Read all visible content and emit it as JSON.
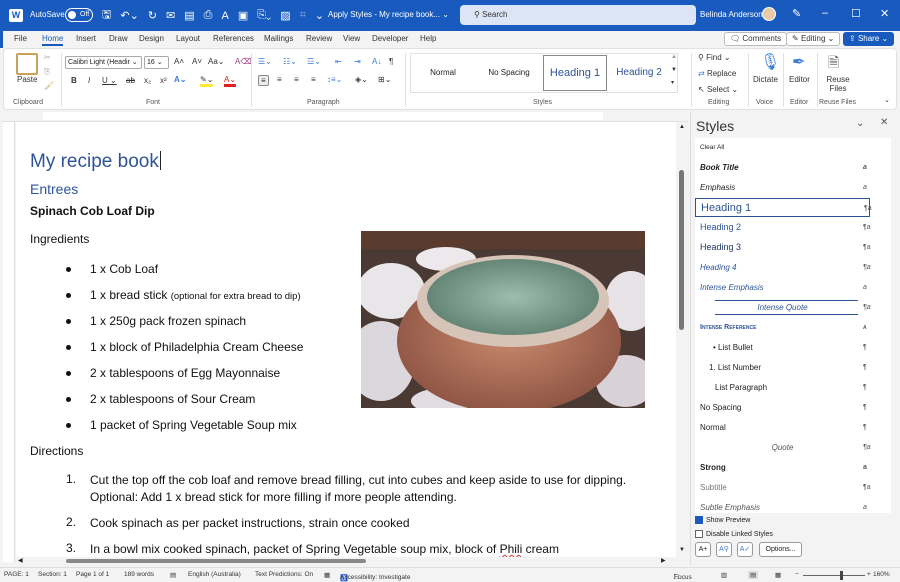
{
  "titlebar": {
    "app_icon": "W",
    "autosave_label": "AutoSave",
    "autosave_state": "Off",
    "quick_access_icons": [
      "save-icon",
      "undo-icon",
      "redo-icon",
      "mail-icon",
      "print-preview-icon",
      "print-icon",
      "read-aloud-icon",
      "form-icon",
      "paste-special-icon",
      "screenshot-icon",
      "touch-mode-icon",
      "customize-icon"
    ],
    "doc_title": "Apply Styles - My recipe book... ⌄",
    "search_placeholder": "Search",
    "user_name": "Belinda Anderson",
    "minimize": "–",
    "maximize": "☐",
    "close": "✕"
  },
  "menu": {
    "tabs": [
      "File",
      "Home",
      "Insert",
      "Draw",
      "Design",
      "Layout",
      "References",
      "Mailings",
      "Review",
      "View",
      "Developer",
      "Help"
    ],
    "active": "Home",
    "comments_label": "Comments",
    "editing_label": "Editing ⌄",
    "share_label": "Share"
  },
  "ribbon": {
    "clipboard": {
      "paste": "Paste",
      "label": "Clipboard"
    },
    "font": {
      "name": "Calibri Light (Headir",
      "size": "16",
      "label": "Font"
    },
    "paragraph": {
      "label": "Paragraph"
    },
    "styles": {
      "items": [
        "Normal",
        "No Spacing",
        "Heading 1",
        "Heading 2"
      ],
      "selected": "Heading 1",
      "label": "Styles"
    },
    "editing": {
      "find": "Find",
      "replace": "Replace",
      "select": "Select",
      "label": "Editing"
    },
    "voice": {
      "dictate": "Dictate",
      "label": "Voice"
    },
    "editor": {
      "editor": "Editor",
      "label": "Editor"
    },
    "reuse": {
      "reuse": "Reuse Files",
      "label": "Reuse Files"
    }
  },
  "document": {
    "title": "My recipe book",
    "section": "Entrees",
    "recipe": "Spinach Cob Loaf Dip",
    "ingredients_heading": "Ingredients",
    "ingredients": [
      {
        "text": "1 x Cob Loaf",
        "note": ""
      },
      {
        "text": "1 x bread stick ",
        "note": "(optional for extra bread to dip)"
      },
      {
        "text": "1 x 250g pack frozen spinach",
        "note": ""
      },
      {
        "text": "1 x block of Philadelphia Cream Cheese",
        "note": ""
      },
      {
        "text": "2 x tablespoons of Egg Mayonnaise",
        "note": ""
      },
      {
        "text": "2 x tablespoons of Sour Cream",
        "note": ""
      },
      {
        "text": "1 packet of Spring Vegetable Soup mix",
        "note": ""
      }
    ],
    "directions_heading": "Directions",
    "directions": [
      {
        "n": "1.",
        "text": "Cut the top off the cob loaf and remove bread filling, cut into cubes and keep aside to use for dipping. Optional: Add 1 x bread stick for more filling if more people attending."
      },
      {
        "n": "2.",
        "text": "Cook spinach as per packet instructions, strain once cooked"
      },
      {
        "n": "3.",
        "text_before": "In a bowl mix cooked spinach, packet of Spring Vegetable soup mix, block of ",
        "misspelled": "Phili",
        "text_after": " cream"
      }
    ],
    "image_alt": "Spinach dip in cob loaf"
  },
  "styles_pane": {
    "title": "Styles",
    "items": [
      {
        "name": "Clear All",
        "mark": ""
      },
      {
        "name": "Book Title",
        "mark": "a"
      },
      {
        "name": "Emphasis",
        "mark": "a"
      },
      {
        "name": "Heading 1",
        "mark": "¶a"
      },
      {
        "name": "Heading 2",
        "mark": "¶a"
      },
      {
        "name": "Heading 3",
        "mark": "¶a"
      },
      {
        "name": "Heading 4",
        "mark": "¶a"
      },
      {
        "name": "Intense Emphasis",
        "mark": "a"
      },
      {
        "name": "Intense Quote",
        "mark": "¶a"
      },
      {
        "name": "Intense Reference",
        "mark": "a"
      },
      {
        "name": "• List Bullet",
        "mark": "¶"
      },
      {
        "name": "1. List Number",
        "mark": "¶"
      },
      {
        "name": "List Paragraph",
        "mark": "¶"
      },
      {
        "name": "No Spacing",
        "mark": "¶"
      },
      {
        "name": "Normal",
        "mark": "¶"
      },
      {
        "name": "Quote",
        "mark": "¶a"
      },
      {
        "name": "Strong",
        "mark": "a"
      },
      {
        "name": "Subtitle",
        "mark": "¶a"
      },
      {
        "name": "Subtle Emphasis",
        "mark": "a"
      }
    ],
    "selected": "Heading 1",
    "show_preview": {
      "label": "Show Preview",
      "checked": true
    },
    "disable_linked": {
      "label": "Disable Linked Styles",
      "checked": false
    },
    "options_label": "Options..."
  },
  "status": {
    "page": "PAGE: 1",
    "section": "Section: 1",
    "pages": "Page 1 of 1",
    "words": "189 words",
    "language": "English (Australia)",
    "predictions": "Text Predictions: On",
    "accessibility": "Accessibility: Investigate",
    "focus": "Focus",
    "zoom": "160%",
    "zoom_level": 0.6
  }
}
